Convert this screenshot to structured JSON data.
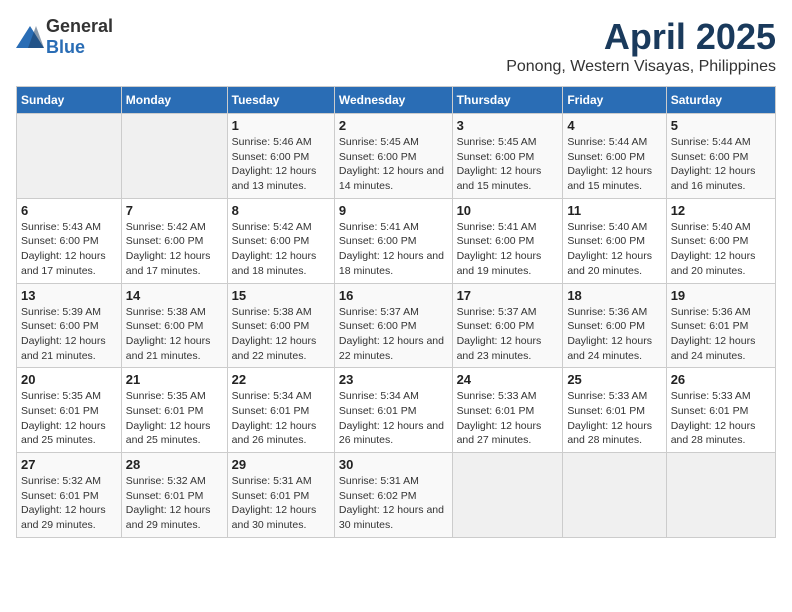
{
  "header": {
    "logo_general": "General",
    "logo_blue": "Blue",
    "title": "April 2025",
    "subtitle": "Ponong, Western Visayas, Philippines"
  },
  "calendar": {
    "weekdays": [
      "Sunday",
      "Monday",
      "Tuesday",
      "Wednesday",
      "Thursday",
      "Friday",
      "Saturday"
    ],
    "weeks": [
      [
        {
          "day": "",
          "sunrise": "",
          "sunset": "",
          "daylight": ""
        },
        {
          "day": "",
          "sunrise": "",
          "sunset": "",
          "daylight": ""
        },
        {
          "day": "1",
          "sunrise": "Sunrise: 5:46 AM",
          "sunset": "Sunset: 6:00 PM",
          "daylight": "Daylight: 12 hours and 13 minutes."
        },
        {
          "day": "2",
          "sunrise": "Sunrise: 5:45 AM",
          "sunset": "Sunset: 6:00 PM",
          "daylight": "Daylight: 12 hours and 14 minutes."
        },
        {
          "day": "3",
          "sunrise": "Sunrise: 5:45 AM",
          "sunset": "Sunset: 6:00 PM",
          "daylight": "Daylight: 12 hours and 15 minutes."
        },
        {
          "day": "4",
          "sunrise": "Sunrise: 5:44 AM",
          "sunset": "Sunset: 6:00 PM",
          "daylight": "Daylight: 12 hours and 15 minutes."
        },
        {
          "day": "5",
          "sunrise": "Sunrise: 5:44 AM",
          "sunset": "Sunset: 6:00 PM",
          "daylight": "Daylight: 12 hours and 16 minutes."
        }
      ],
      [
        {
          "day": "6",
          "sunrise": "Sunrise: 5:43 AM",
          "sunset": "Sunset: 6:00 PM",
          "daylight": "Daylight: 12 hours and 17 minutes."
        },
        {
          "day": "7",
          "sunrise": "Sunrise: 5:42 AM",
          "sunset": "Sunset: 6:00 PM",
          "daylight": "Daylight: 12 hours and 17 minutes."
        },
        {
          "day": "8",
          "sunrise": "Sunrise: 5:42 AM",
          "sunset": "Sunset: 6:00 PM",
          "daylight": "Daylight: 12 hours and 18 minutes."
        },
        {
          "day": "9",
          "sunrise": "Sunrise: 5:41 AM",
          "sunset": "Sunset: 6:00 PM",
          "daylight": "Daylight: 12 hours and 18 minutes."
        },
        {
          "day": "10",
          "sunrise": "Sunrise: 5:41 AM",
          "sunset": "Sunset: 6:00 PM",
          "daylight": "Daylight: 12 hours and 19 minutes."
        },
        {
          "day": "11",
          "sunrise": "Sunrise: 5:40 AM",
          "sunset": "Sunset: 6:00 PM",
          "daylight": "Daylight: 12 hours and 20 minutes."
        },
        {
          "day": "12",
          "sunrise": "Sunrise: 5:40 AM",
          "sunset": "Sunset: 6:00 PM",
          "daylight": "Daylight: 12 hours and 20 minutes."
        }
      ],
      [
        {
          "day": "13",
          "sunrise": "Sunrise: 5:39 AM",
          "sunset": "Sunset: 6:00 PM",
          "daylight": "Daylight: 12 hours and 21 minutes."
        },
        {
          "day": "14",
          "sunrise": "Sunrise: 5:38 AM",
          "sunset": "Sunset: 6:00 PM",
          "daylight": "Daylight: 12 hours and 21 minutes."
        },
        {
          "day": "15",
          "sunrise": "Sunrise: 5:38 AM",
          "sunset": "Sunset: 6:00 PM",
          "daylight": "Daylight: 12 hours and 22 minutes."
        },
        {
          "day": "16",
          "sunrise": "Sunrise: 5:37 AM",
          "sunset": "Sunset: 6:00 PM",
          "daylight": "Daylight: 12 hours and 22 minutes."
        },
        {
          "day": "17",
          "sunrise": "Sunrise: 5:37 AM",
          "sunset": "Sunset: 6:00 PM",
          "daylight": "Daylight: 12 hours and 23 minutes."
        },
        {
          "day": "18",
          "sunrise": "Sunrise: 5:36 AM",
          "sunset": "Sunset: 6:00 PM",
          "daylight": "Daylight: 12 hours and 24 minutes."
        },
        {
          "day": "19",
          "sunrise": "Sunrise: 5:36 AM",
          "sunset": "Sunset: 6:01 PM",
          "daylight": "Daylight: 12 hours and 24 minutes."
        }
      ],
      [
        {
          "day": "20",
          "sunrise": "Sunrise: 5:35 AM",
          "sunset": "Sunset: 6:01 PM",
          "daylight": "Daylight: 12 hours and 25 minutes."
        },
        {
          "day": "21",
          "sunrise": "Sunrise: 5:35 AM",
          "sunset": "Sunset: 6:01 PM",
          "daylight": "Daylight: 12 hours and 25 minutes."
        },
        {
          "day": "22",
          "sunrise": "Sunrise: 5:34 AM",
          "sunset": "Sunset: 6:01 PM",
          "daylight": "Daylight: 12 hours and 26 minutes."
        },
        {
          "day": "23",
          "sunrise": "Sunrise: 5:34 AM",
          "sunset": "Sunset: 6:01 PM",
          "daylight": "Daylight: 12 hours and 26 minutes."
        },
        {
          "day": "24",
          "sunrise": "Sunrise: 5:33 AM",
          "sunset": "Sunset: 6:01 PM",
          "daylight": "Daylight: 12 hours and 27 minutes."
        },
        {
          "day": "25",
          "sunrise": "Sunrise: 5:33 AM",
          "sunset": "Sunset: 6:01 PM",
          "daylight": "Daylight: 12 hours and 28 minutes."
        },
        {
          "day": "26",
          "sunrise": "Sunrise: 5:33 AM",
          "sunset": "Sunset: 6:01 PM",
          "daylight": "Daylight: 12 hours and 28 minutes."
        }
      ],
      [
        {
          "day": "27",
          "sunrise": "Sunrise: 5:32 AM",
          "sunset": "Sunset: 6:01 PM",
          "daylight": "Daylight: 12 hours and 29 minutes."
        },
        {
          "day": "28",
          "sunrise": "Sunrise: 5:32 AM",
          "sunset": "Sunset: 6:01 PM",
          "daylight": "Daylight: 12 hours and 29 minutes."
        },
        {
          "day": "29",
          "sunrise": "Sunrise: 5:31 AM",
          "sunset": "Sunset: 6:01 PM",
          "daylight": "Daylight: 12 hours and 30 minutes."
        },
        {
          "day": "30",
          "sunrise": "Sunrise: 5:31 AM",
          "sunset": "Sunset: 6:02 PM",
          "daylight": "Daylight: 12 hours and 30 minutes."
        },
        {
          "day": "",
          "sunrise": "",
          "sunset": "",
          "daylight": ""
        },
        {
          "day": "",
          "sunrise": "",
          "sunset": "",
          "daylight": ""
        },
        {
          "day": "",
          "sunrise": "",
          "sunset": "",
          "daylight": ""
        }
      ]
    ]
  }
}
